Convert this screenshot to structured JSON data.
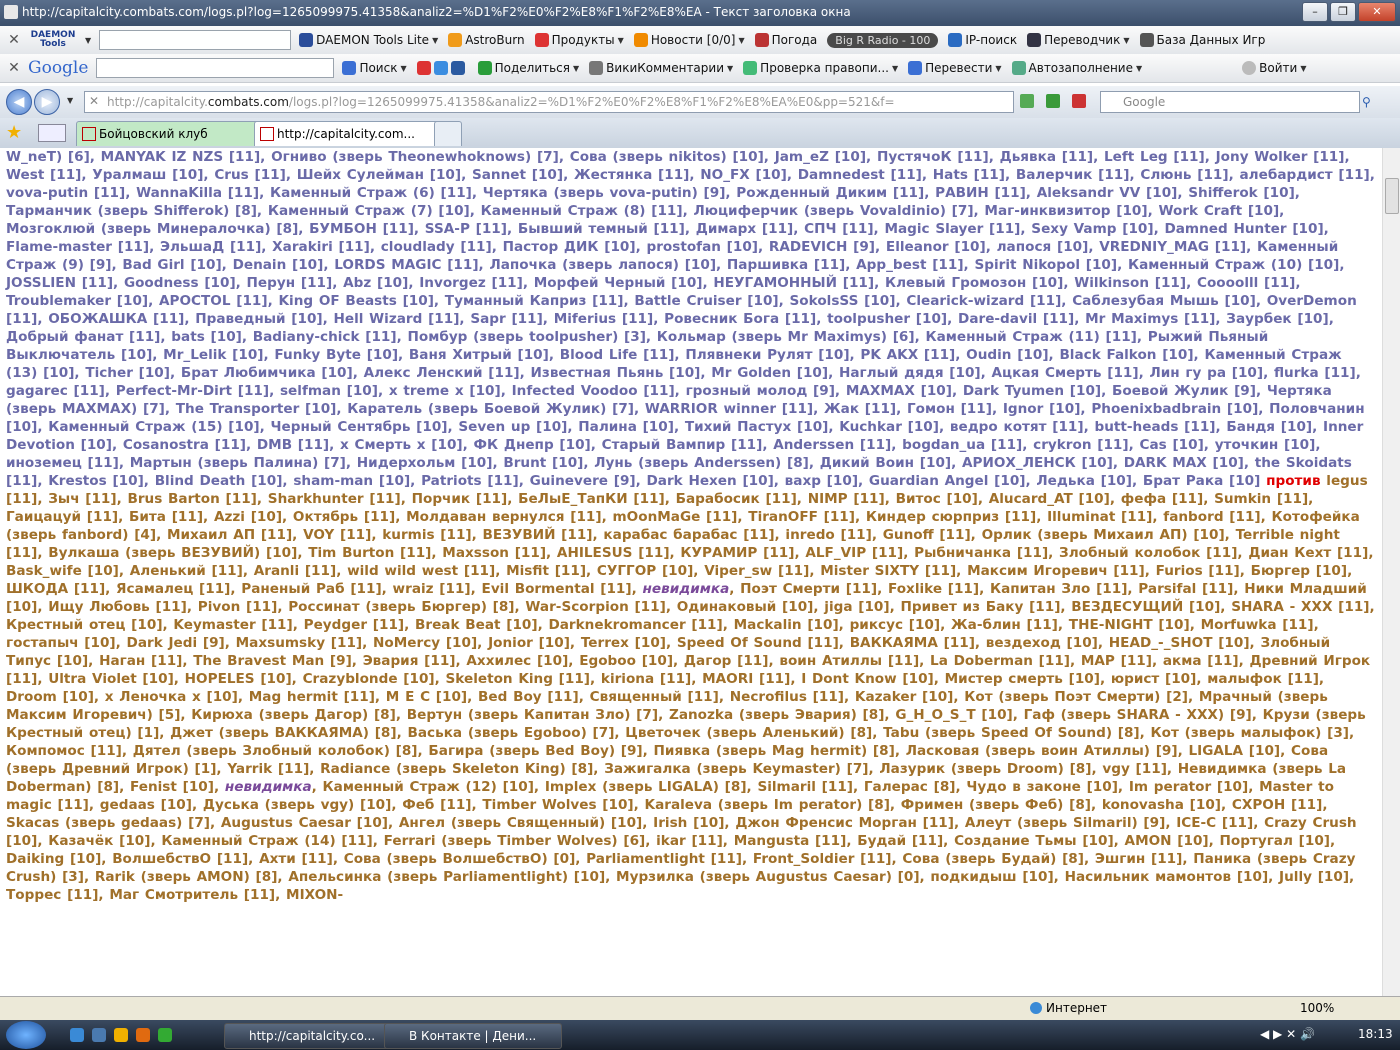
{
  "window": {
    "title": "http://capitalcity.combats.com/logs.pl?log=1265099975.41358&analiz2=%D1%F2%E0%F2%E8%F1%F2%E8%EA - Текст заголовка окна"
  },
  "toolbar1": {
    "daemon_logo": "DAEMON Tools",
    "items": [
      "DAEMON Tools Lite",
      "AstroBurn",
      "Продукты",
      "Новости [0/0]",
      "Погода",
      "Big R Radio - 100",
      "IP-поиск",
      "Переводчик",
      "База Данных Игр"
    ]
  },
  "toolbar2": {
    "logo": "Google",
    "items": [
      "Поиск",
      "Поделиться",
      "ВикиКомментарии",
      "Проверка правопи...",
      "Перевести",
      "Автозаполнение",
      "Войти"
    ]
  },
  "address": {
    "url_prefix": "http://capitalcity.",
    "url_domain": "combats.com",
    "url_rest": "/logs.pl?log=1265099975.41358&analiz2=%D1%F2%E0%F2%E8%F1%F2%E8%EA%E0&pp=521&f=",
    "search_placeholder": "Google"
  },
  "tabs": [
    {
      "label": "Бойцовский клуб"
    },
    {
      "label": "http://capitalcity.com..."
    }
  ],
  "log": {
    "team1": "W_neT) [6], MANYAK IZ NZS [11], Огниво (зверь Theonewhoknows) [7], Сова (зверь nikitos) [10], Jam_eZ [10], ПустячоК [11], Дьявка [11], Left Leg [11], Jony Wolker [11], West [11], Уралмаш [10], Crus [11], Шейх Сулейман [10], Sannet [10], Жестянка [11], NO_FX [10], Damnedest [11], Hats [11], Валерчик [11], Слюнь [11], алебардист [11], vova-putin [11], WannaKilla [11], Каменный Страж (6) [11], Чертяка (зверь vova-putin) [9], Рожденный Диким [11], РАВИН [11], Aleksandr VV [10], Shifferok [10], Тарманчик (зверь Shifferok) [8], Каменный Страж (7) [10], Каменный Страж (8) [11], Люциферчик (зверь Vovaldinio) [7], Маг-инквизитор [10], Work Craft [10], Мозгоклюй (зверь Минералочка) [8], БУМБОН [11], SSA-P [11], Бывший темный [11], Димарх [11], СПЧ [11], Magic Slayer [11], Sexy Vamp [10], Damned Hunter [10], Flame-master [11], ЭльшаД [11], Xarakiri [11], cloudlady [11], Пастор ДИК [10], prostofan [10], RADEVICH [9], Elleanor [10], лапося [10], VREDNIY_MAG [11], Каменный Страж (9) [9], Bad Girl [10], Denain [10], LORDS MAGIC [11], Лапочка (зверь лапося) [10], Паршивка [11], App_best [11], Spirit Nikopol [10], Каменный Страж (10) [10], JOSSLIEN [11], Goodness [10], Перун [11], Abz [10], Invorgez [11], Морфей Черный [10], НЕУГАМОННЫЙ [11], Клевый Громозон [10], Wilkinson [11], Coooolll [11], Troublemaker [10], APOCTOL [11], King OF Beasts [10], Туманный Каприз [11], Battle Cruiser [10], SokolsSS [10], Clearick-wizard [11], Саблезубая Мышь [10], OverDemon [11], ОБОЖАШКА [11], Праведный [10], Hell Wizard [11], Sapr [11], Miferius [11], Ровесник Бога [11], toolpusher [10], Dare-davil [11], Mr Maximys [11], Заурбек [10], Добрый фанат [11], bats [10], Badiany-chick [11], Помбур (зверь toolpusher) [3], Кольмар (зверь Mr Maximys) [6], Каменный Страж (11) [11], Рыжий Пьяный Выключатель [10], Mr_Lelik [10], Funky Byte [10], Ваня Хитрый [10], Blood Life [11], Плявнеки Рулят [10], PK AKX [11], Oudin [10], Black Falkon [10], Каменный Страж (13) [10], Ticher [10], Брат Любимчика [10], Алекс Ленский [11], Известная Пьянь [10], Mr Golden [10], Наглый дядя [10], Ацкая Смерть [11], Лин гу ра [10], flurka [11], gagarec [11], Perfect-Mr-Dirt [11], selfman [10], x treme x [10], Infected Voodoo [11], грозный молод [9], MAXMAX [10], Dark Tyumen [10], Боевой Жулик [9], Чертяка (зверь MAXMAX) [7], The Transporter [10], Каратель (зверь Боевой Жулик) [7], WARRIOR winner [11], Жак [11], Гомон [11], Ignor [10], Phoenixbadbrain [10], Половчанин [10], Каменный Страж (15) [10], Черный Сентябрь [10], Seven up [10], Палина [10], Тихий Пастух [10], Kuchkar [10], ведро котят [11], butt-heads [11], Бандя [10], Inner Devotion [10], Cosanostra [11], DMB [11], х Смерть х [10], ФК Днепр [10], Старый Вампир [11], Anderssen [11], bogdan_ua [11], crykron [11], Cas [10], уточкин [10], иноземец [11], Мартын (зверь Палина) [7], Нидерхольм [10], Brunt [10], Лунь (зверь Anderssen) [8], Дикий Воин [10], АРИОХ_ЛЕНСК [10], DARK MAX [10], the Skoidats [11], Krestos [10], Blind Death [10], sham-man [10], Patriots [11], Guinevere [9], Dark Hexen [10], вахр [10], Guardian Angel [10], Ледька [10], Брат Рака [10]",
    "versus": "против",
    "team2": "legus [11], Зыч [11], Brus Barton [11], Sharkhunter [11], Порчик [11], БеЛыЕ_ТапКИ [11], Барабосик [11], NIMP [11], Витос [10], Alucard_AT [10], фефа [11], Sumkin [11], Гаицацуй [11], Бита [11], Azzi [10], Октябрь [11], Молдаван вернулся [11], mOonMaGe [11], TiranOFF [11], Киндер сюрприз [11], Illuminat [11], fanbord [11], Котофейка (зверь fanbord) [4], Михаил АП [11], VOY [11], kurmis [11], ВЕЗУВИЙ [11], карабас барабас [11], inredo [11], Gunoff [11], Орлик (зверь Михаил АП) [10], Terrible night [11], Вулкаша (зверь ВЕЗУВИЙ) [10], Tim Burton [11], Maxsson [11], AHILESUS [11], КУРАМИР [11], ALF_VIP [11], Рыбничанка [11], Злобный колобок [11], Диан Кехт [11], Bask_wife [10], Аленький [11], Aranli [11], wild wild west [11], Misfit [11], СУГГОР [10], Viper_sw [11], Mister SIXTY [11], Максим Игоревич [11], Furios [11], Бюргер [10], ШКОДА [11], Ясамалец [11], Раненый Раб [11], wraiz [11], Evil Bormental [11],",
    "invisible1": "невидимка",
    "team2b": ", Поэт Смерти [11], Foxlike [11], Капитан Зло [11], Parsifal [11], Ники Младший [10], Ищу Любовь [11], Pivon [11], Россинат (зверь Бюргер) [8], War-Scorpion [11], Одинаковый [10], jiga [10], Привет из Баку [11], ВЕЗДЕСУЩИЙ [10], SHARA - XXX [11], Крестный отец [10], Keymaster [11], Peydger [11], Break Beat [10], Darknekromancer [11], Mackalin [10], риксус [10], Жа-блин [11], THE-NIGHT [10], Morfuwka [11], гостапыч [10], Dark Jedi [9], Maxsumsky [11], NoMercy [10], Jonior [10], Terrex [10], Speed Of Sound [11], ВАККАЯМА [11], вездеход [10], HEAD_-_SHOT [10], Злобный Типус [10], Наган [11], The Bravest Man [9], Эвария [11], Аххилес [10], Egoboo [10], Дагор [11], воин Атиллы [11], La Doberman [11], MAP [11], акма [11], Древний Игрок [11], Ultra Violet [10], HOPELES [10], Crazyblonde [10], Skeleton King [11], kiriona [11], MAORI [11], I Dont Know [10], Мистер смерть [10], юрист [10], малыфок [11], Droom [10], x Леночка x [10], Mag hermit [11], M E C [10], Bed Boy [11], Священный [11], Necrofilus [11], Kazaker [10], Кот (зверь Поэт Смерти) [2], Мрачный (зверь Максим Игоревич) [5], Кирюха (зверь Дагор) [8], Вертун (зверь Капитан Зло) [7], Zanozka (зверь Эвария) [8], G_H_O_S_T [10], Гаф (зверь SHARA - XXX) [9], Крузи (зверь Крестный отец) [1], Джет (зверь ВАККАЯМА) [8], Васька (зверь Egoboo) [7], Цветочек (зверь Аленький) [8], Tabu (зверь Speed Of Sound) [8], Кот (зверь малыфок) [3], Компомос [11], Дятел (зверь Злобный колобок) [8], Багира (зверь Bed Boy) [9], Пиявка (зверь Mag hermit) [8], Ласковая (зверь воин Атиллы) [9], LIGALA [10], Сова (зверь Древний Игрок) [1], Yarrik [11], Radiance (зверь Skeleton King) [8], Зажигалка (зверь Keymaster) [7], Лазурик (зверь Droom) [8], vgy [11], Невидимка (зверь La Doberman) [8], Fenist [10],",
    "invisible2": "невидимка",
    "team2c": ", Каменный Страж (12) [10], Implex (зверь LIGALA) [8], Silmaril [11], Галерас [8], Чудо в законе [10], Im perator [10], Master to magic [11], gedaas [10], Дуська (зверь vgy) [10], Феб [11], Timber Wolves [10], Karaleva (зверь Im perator) [8], Фримен (зверь Феб) [8], konovasha [10], СХРОН [11], Skacas (зверь gedaas) [7], Augustus Caesar [10], Ангел (зверь Священный) [10], Irish [10], Джон Френсис Морган [11], Алеут (зверь Silmaril) [9], ICE-C [11], Crazy Crush [10], Казачёк [10], Каменный Страж (14) [11], Ferrari (зверь Timber Wolves) [6], ikar [11], Mangusta [11], Будай [11], Создание Тьмы [10], AMON [10], Португал [10], Daiking [10], ВолшебствО [11], Ахти [11], Сова (зверь ВолшебствО) [0], Parliamentlight [11], Front_Soldier [11], Сова (зверь Будай) [8], Эшгин [11], Паника (зверь Crazy Crush) [3], Rarik (зверь AMON) [8], Апельсинка (зверь Parliamentlight) [10], Мурзилка (зверь Augustus Caesar) [0], подкидыш [10], Насильник мамонтов [10], Jully [10], Торрес [11], Маг Смотритель [11], MIXON-"
  },
  "statusbar": {
    "zone": "Интернет",
    "zoom": "100%"
  },
  "taskbar": {
    "tasks": [
      "http://capitalcity.co...",
      "В Контакте | Дени..."
    ],
    "clock": "18:13"
  },
  "colors": {
    "team1": "#6a6aa8",
    "team2": "#a0702a",
    "versus": "#e00000"
  }
}
